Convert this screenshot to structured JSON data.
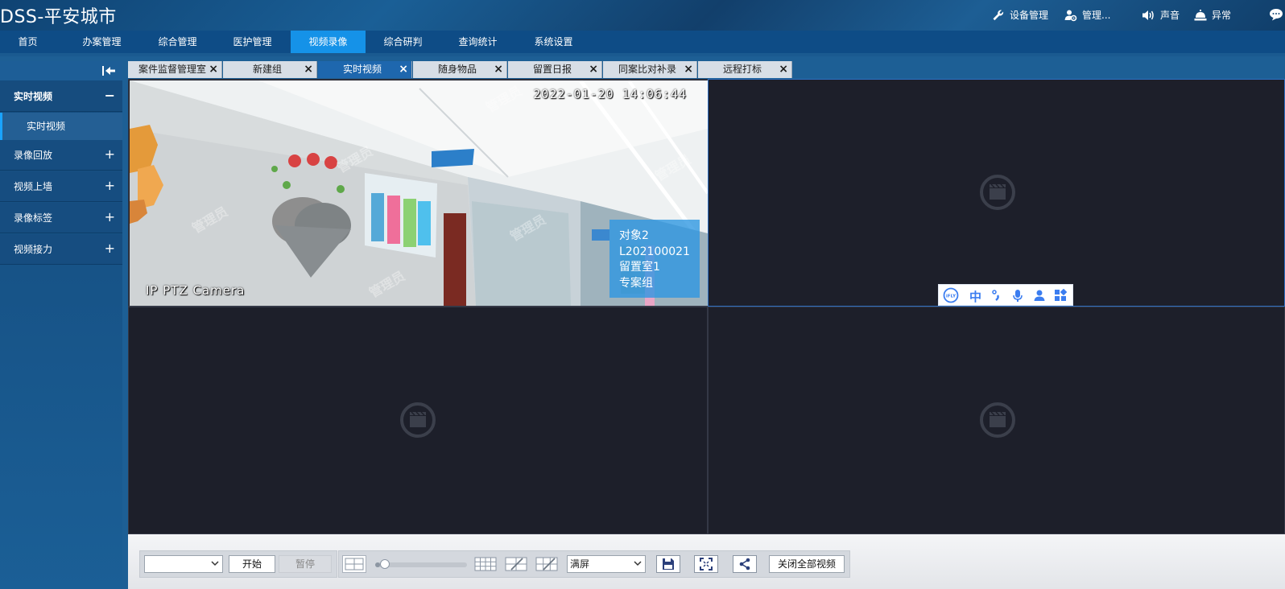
{
  "app": {
    "title": "DSS-平安城市"
  },
  "header": {
    "items": [
      {
        "label": "设备管理",
        "icon": "wrench-icon"
      },
      {
        "label": "管理...",
        "icon": "user-gear-icon"
      },
      {
        "label": "声音",
        "icon": "speaker-icon"
      },
      {
        "label": "异常",
        "icon": "bell-icon"
      }
    ],
    "chat_icon": "chat-icon"
  },
  "nav": {
    "items": [
      "首页",
      "办案管理",
      "综合管理",
      "医护管理",
      "视频录像",
      "综合研判",
      "查询统计",
      "系统设置"
    ],
    "active_index": 4
  },
  "sidebar": {
    "collapse_icon": "collapse-left-icon",
    "groups": [
      {
        "label": "实时视频",
        "toggle": "−",
        "expanded": true
      },
      {
        "label": "录像回放",
        "toggle": "+"
      },
      {
        "label": "视频上墙",
        "toggle": "+"
      },
      {
        "label": "录像标签",
        "toggle": "+"
      },
      {
        "label": "视频接力",
        "toggle": "+"
      }
    ],
    "sub_items": [
      "实时视频"
    ]
  },
  "tabs": {
    "items": [
      "案件监督管理室",
      "新建组",
      "实时视频",
      "随身物品",
      "留置日报",
      "同案比对补录",
      "远程打标"
    ],
    "active_index": 2,
    "close_glyph": "×"
  },
  "video": {
    "timestamp": "2022-01-20 14:06:44",
    "camera_name": "IP PTZ Camera",
    "overlay": {
      "subject": "对象2",
      "id": "L202100021",
      "room": "留置室1",
      "group": "专案组"
    },
    "watermark": "管理员",
    "placeholder_icon": "video-off-icon"
  },
  "ime": {
    "logo": "iFLY",
    "mode": "中",
    "icons": [
      "punctuation-icon",
      "microphone-icon",
      "user-icon",
      "apps-icon"
    ]
  },
  "toolbar": {
    "select_value": "",
    "start_label": "开始",
    "pause_label": "暂停",
    "layout_value": "满屏",
    "close_all_label": "关闭全部视频",
    "slider_level": 0.05
  },
  "colors": {
    "nav_active": "#1592e8",
    "tab_active": "#1e67ae",
    "overlay": "#2c96e2",
    "ime_blue": "#3b7df0"
  }
}
